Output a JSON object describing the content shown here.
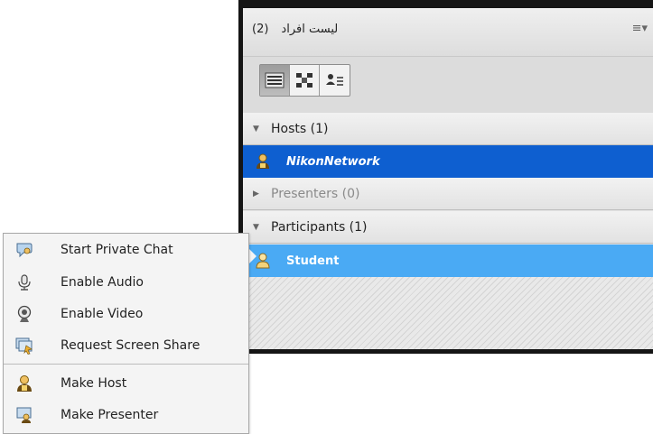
{
  "pod": {
    "title": "لیست افراد",
    "count": "(2)",
    "menu_icon": "≡▾",
    "view_buttons": [
      {
        "name": "list-view-icon",
        "active": true
      },
      {
        "name": "breakout-view-icon",
        "active": false
      },
      {
        "name": "status-view-icon",
        "active": false
      }
    ],
    "groups": {
      "hosts_label": "Hosts (1)",
      "presenters_label": "Presenters (0)",
      "participants_label": "Participants (1)"
    },
    "users": {
      "host_name": "NikonNetwork",
      "participant_name": "Student"
    }
  },
  "context_menu": {
    "items": [
      {
        "label": "Start Private Chat",
        "icon": "chat-bubble-icon"
      },
      {
        "label": "Enable Audio",
        "icon": "microphone-icon"
      },
      {
        "label": "Enable Video",
        "icon": "webcam-icon"
      },
      {
        "label": "Request Screen Share",
        "icon": "screen-share-icon"
      },
      {
        "label": "Make Host",
        "icon": "host-icon"
      },
      {
        "label": "Make Presenter",
        "icon": "presenter-icon"
      }
    ]
  },
  "colors": {
    "host_row": "#0e5fd0",
    "participant_row": "#4aaaf4",
    "pod_frame": "#151515"
  }
}
